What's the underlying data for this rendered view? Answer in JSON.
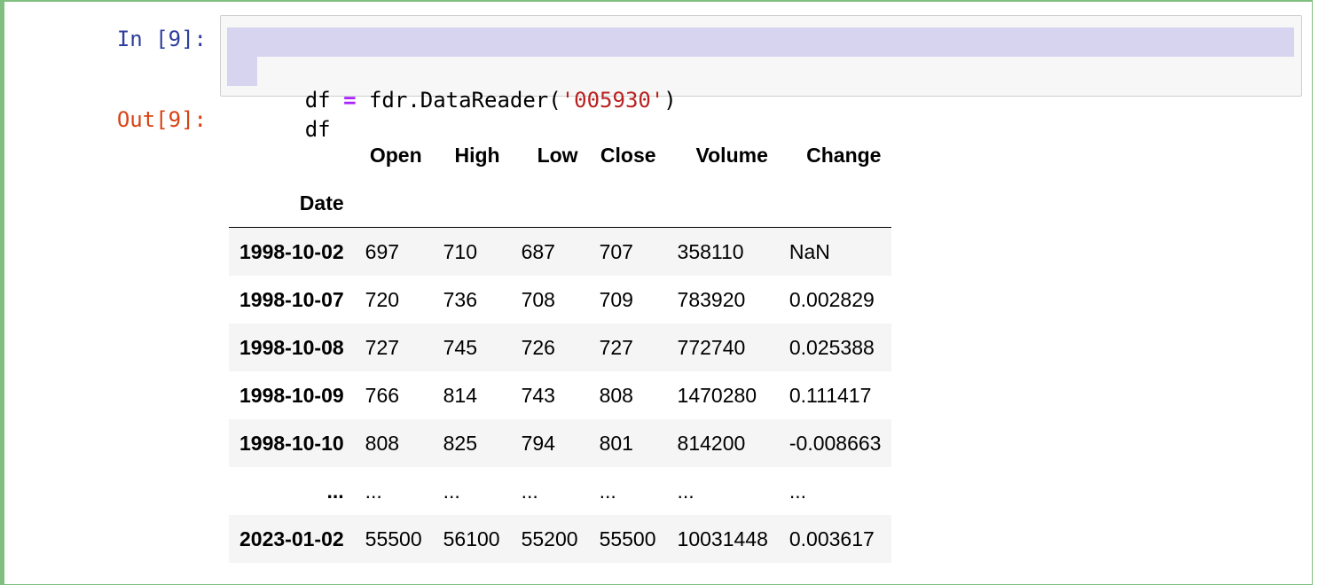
{
  "cell": {
    "in_prompt": "In [9]:",
    "out_prompt": "Out[9]:",
    "code": {
      "line1": {
        "var": "df",
        "op": "=",
        "call": " fdr.DataReader(",
        "arg": "'005930'",
        "close": ")"
      },
      "line2": "df"
    }
  },
  "dataframe": {
    "columns": [
      "Open",
      "High",
      "Low",
      "Close",
      "Volume",
      "Change"
    ],
    "index_name": "Date",
    "rows": [
      {
        "index": "1998-10-02",
        "values": [
          "697",
          "710",
          "687",
          "707",
          "358110",
          "NaN"
        ]
      },
      {
        "index": "1998-10-07",
        "values": [
          "720",
          "736",
          "708",
          "709",
          "783920",
          "0.002829"
        ]
      },
      {
        "index": "1998-10-08",
        "values": [
          "727",
          "745",
          "726",
          "727",
          "772740",
          "0.025388"
        ]
      },
      {
        "index": "1998-10-09",
        "values": [
          "766",
          "814",
          "743",
          "808",
          "1470280",
          "0.111417"
        ]
      },
      {
        "index": "1998-10-10",
        "values": [
          "808",
          "825",
          "794",
          "801",
          "814200",
          "-0.008663"
        ]
      },
      {
        "index": "...",
        "values": [
          "...",
          "...",
          "...",
          "...",
          "...",
          "..."
        ]
      },
      {
        "index": "2023-01-02",
        "values": [
          "55500",
          "56100",
          "55200",
          "55500",
          "10031448",
          "0.003617"
        ]
      }
    ]
  },
  "colors": {
    "cell_border": "#7fbf7f",
    "in_prompt": "#303f9f",
    "out_prompt": "#d84315",
    "selection": "#d7d4f0"
  }
}
